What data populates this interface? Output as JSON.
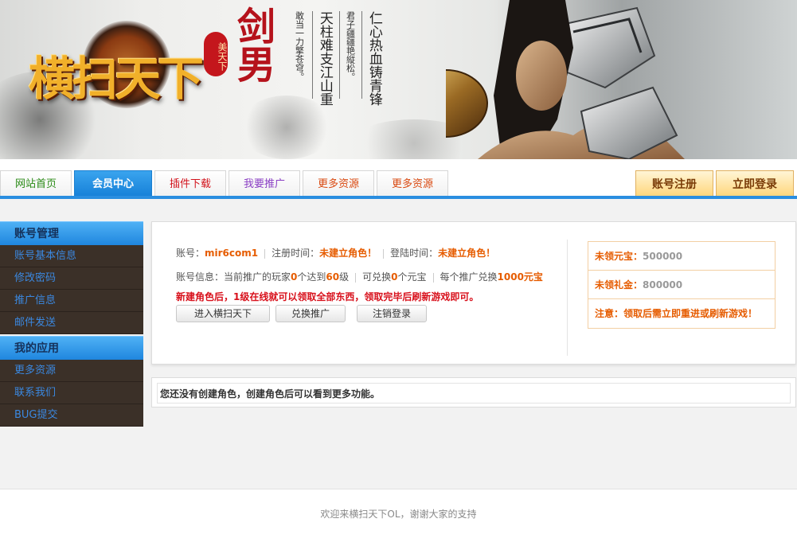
{
  "banner": {
    "logo_text": "横扫天下",
    "seal_text": "美天下",
    "calligraphy": "剑男",
    "poem_small_1": "敢当一力擎苍穹。",
    "poem_big_1": "天柱难支江山重",
    "poem_small_2": "君子疆疆艳縦松。",
    "poem_big_2": "仁心热血铸青锋"
  },
  "nav": {
    "tabs": [
      {
        "label": "网站首页"
      },
      {
        "label": "会员中心"
      },
      {
        "label": "插件下载"
      },
      {
        "label": "我要推广"
      },
      {
        "label": "更多资源"
      },
      {
        "label": "更多资源"
      }
    ],
    "register": "账号注册",
    "login": "立即登录"
  },
  "sidebar": {
    "sections": [
      {
        "title": "账号管理",
        "items": [
          "账号基本信息",
          "修改密码",
          "推广信息",
          "邮件发送"
        ]
      },
      {
        "title": "我的应用",
        "items": [
          "更多资源",
          "联系我们",
          "BUG提交"
        ]
      }
    ]
  },
  "account": {
    "account_label": "账号：",
    "account_value": "mir6com1",
    "reg_label": "注册时间：",
    "reg_value": "未建立角色！",
    "login_label": "登陆时间：",
    "login_value": "未建立角色！",
    "info_label": "账号信息：当前推广的玩家",
    "promoted_count": "0",
    "info_mid": "个达到",
    "level": "60",
    "info_level_suffix": "级",
    "exchange_label": "可兑换",
    "exchange_count": "0",
    "exchange_suffix": "个元宝",
    "per_promo_label": "每个推广兑换",
    "per_promo_value": "1000元宝",
    "notice": "新建角色后，1级在线就可以领取全部东西，领取完毕后刷新游戏即可。",
    "buttons": [
      "进入横扫天下",
      "兑换推广",
      "注销登录"
    ]
  },
  "rewards": {
    "yuanbao_label": "未领元宝：",
    "yuanbao_value": "500000",
    "gold_label": "未领礼金：",
    "gold_value": "800000",
    "note": "注意：领取后需立即重进或刷新游戏！"
  },
  "message": "您还没有创建角色，创建角色后可以看到更多功能。",
  "footer": "欢迎来横扫天下OL，谢谢大家的支持",
  "colors": {
    "accent_blue": "#2a8ee0",
    "highlight_orange": "#e65c00",
    "alert_red": "#d8101b",
    "sidebar_bg": "#3b3028"
  }
}
